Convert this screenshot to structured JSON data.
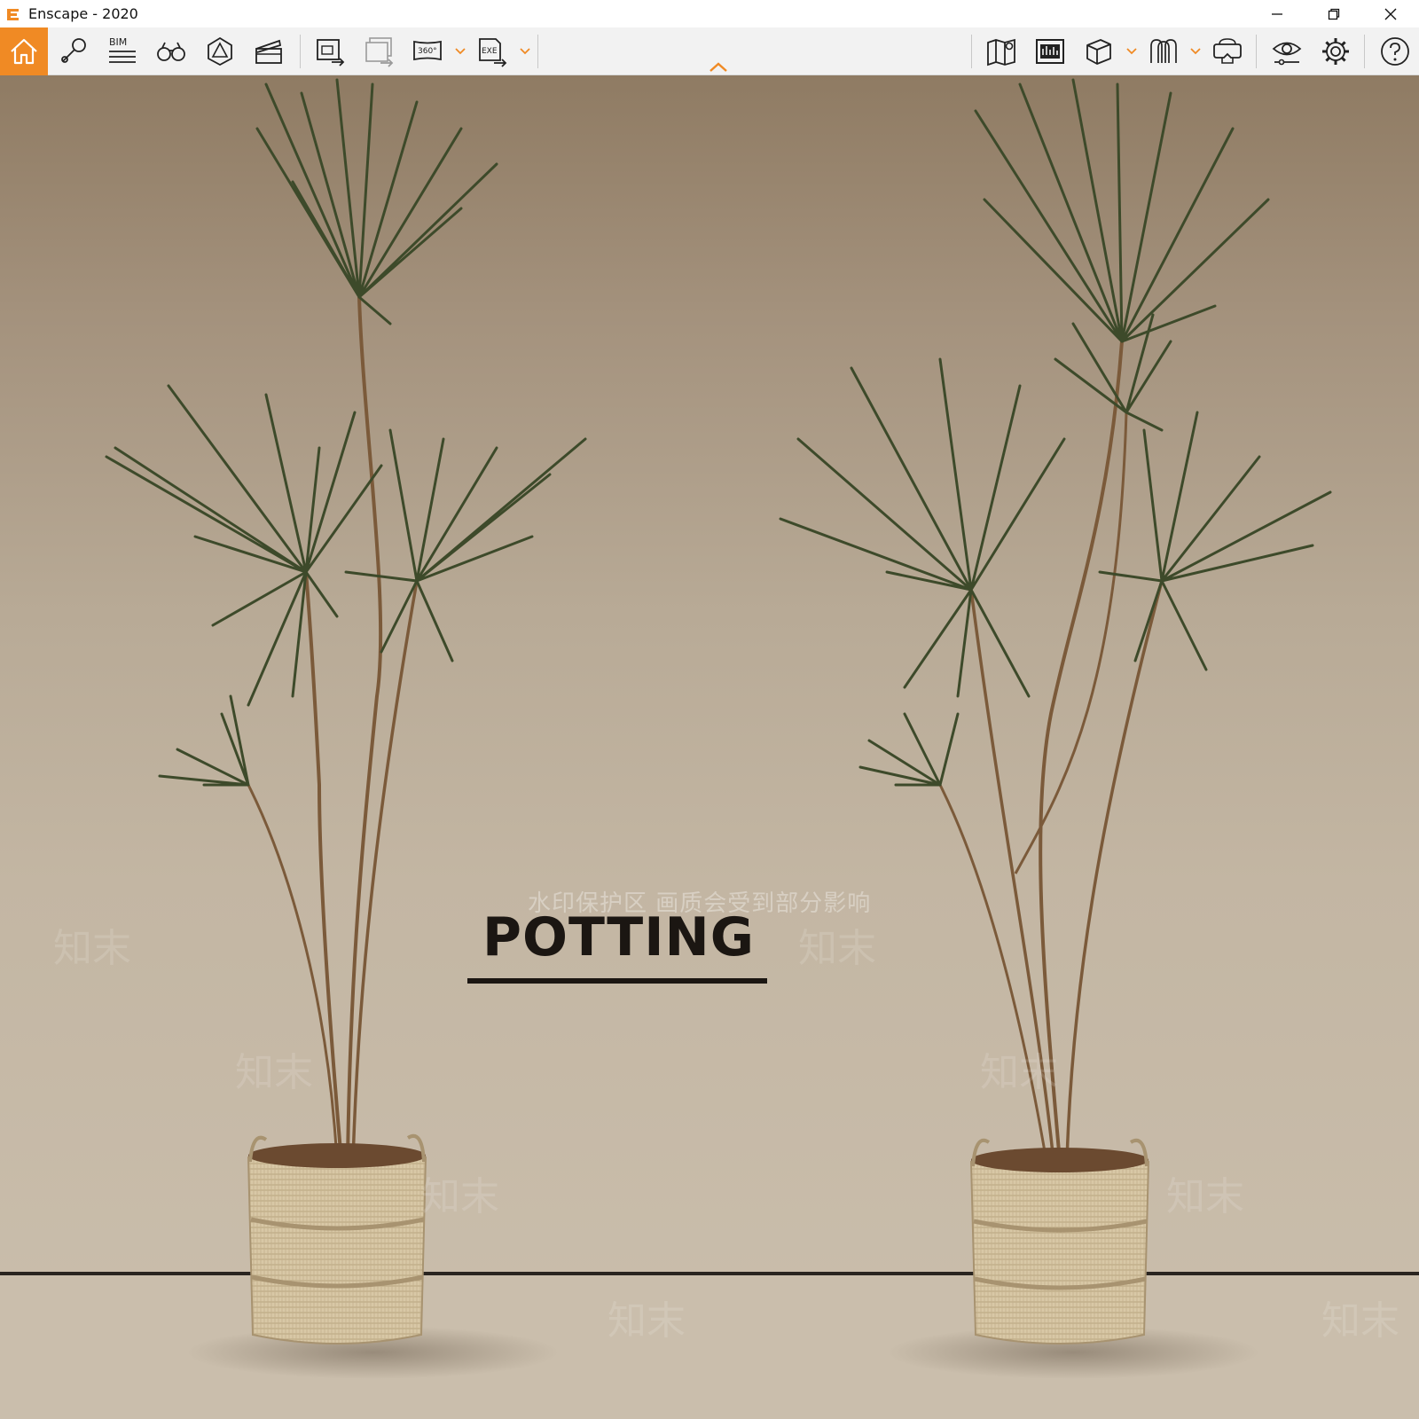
{
  "window": {
    "title": "Enscape - 2020",
    "controls": [
      "minimize-icon",
      "restore-icon",
      "close-icon"
    ]
  },
  "toolbar": {
    "accent_color": "#f08a24",
    "left_buttons": [
      {
        "name": "home",
        "icon": "home-icon",
        "active": true
      },
      {
        "name": "views",
        "icon": "location-pin-icon"
      },
      {
        "name": "bim",
        "icon": "bim-icon",
        "label": "BIM"
      },
      {
        "name": "walk",
        "icon": "binoculars-icon"
      },
      {
        "name": "safe-frame",
        "icon": "safe-frame-icon"
      },
      {
        "name": "video-editor",
        "icon": "clapperboard-icon"
      },
      {
        "name": "screenshot",
        "icon": "screenshot-export-icon"
      },
      {
        "name": "batch-render",
        "icon": "batch-render-icon"
      },
      {
        "name": "panorama",
        "icon": "panorama-360-icon",
        "label": "360°"
      },
      {
        "name": "exe-export",
        "icon": "exe-export-icon",
        "label": "EXE"
      }
    ],
    "right_buttons": [
      {
        "name": "map",
        "icon": "map-icon"
      },
      {
        "name": "gallery",
        "icon": "gallery-icon"
      },
      {
        "name": "asset-library",
        "icon": "cube-icon"
      },
      {
        "name": "materials",
        "icon": "material-icon"
      },
      {
        "name": "vr-headset",
        "icon": "vr-headset-icon"
      },
      {
        "name": "visual-settings",
        "icon": "eye-icon"
      },
      {
        "name": "general-settings",
        "icon": "gear-icon"
      },
      {
        "name": "help",
        "icon": "help-icon"
      }
    ]
  },
  "viewport": {
    "watermark_notice": "水印保护区  画质会受到部分影响",
    "watermark_glyph": "知末",
    "caption": "POTTING"
  }
}
